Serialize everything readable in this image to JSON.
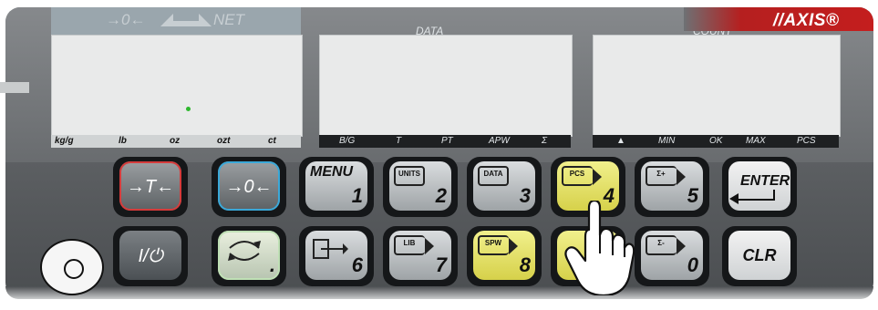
{
  "panel": {
    "indicators_left": [
      "→0←",
      "NET"
    ],
    "data_label": "DATA",
    "count_label": "COUNT",
    "brand": "//AXIS®"
  },
  "units": [
    "kg/g",
    "lb",
    "oz",
    "ozt",
    "ct"
  ],
  "data_units": [
    "B/G",
    "T",
    "PT",
    "APW",
    "Σ"
  ],
  "count_units": [
    "▲",
    "MIN",
    "OK",
    "MAX",
    "PCS"
  ],
  "keys": {
    "tare": "→T←",
    "zero": "→0←",
    "menu": "MENU",
    "menu_num": "1",
    "units": "UNITS",
    "units_num": "2",
    "data": "DATA",
    "data_num": "3",
    "pcs": "PCS",
    "pcs_num": "4",
    "sum_plus": "Σ+",
    "sum_plus_num": "5",
    "enter": "ENTER",
    "power": "I/⏻",
    "dot_num": ".",
    "print_num": "6",
    "lib": "LIB",
    "lib_num": "7",
    "spw": "SPW",
    "spw_num": "8",
    "sum_minus": "Σ-",
    "sum_minus_num": "0",
    "clr": "CLR"
  },
  "colors": {
    "panel": "#5f6265",
    "display": "#e9eaea",
    "accent_red": "#c41e1e",
    "key_yellow": "#e6e26a",
    "status_dot": "#2eb82e"
  }
}
